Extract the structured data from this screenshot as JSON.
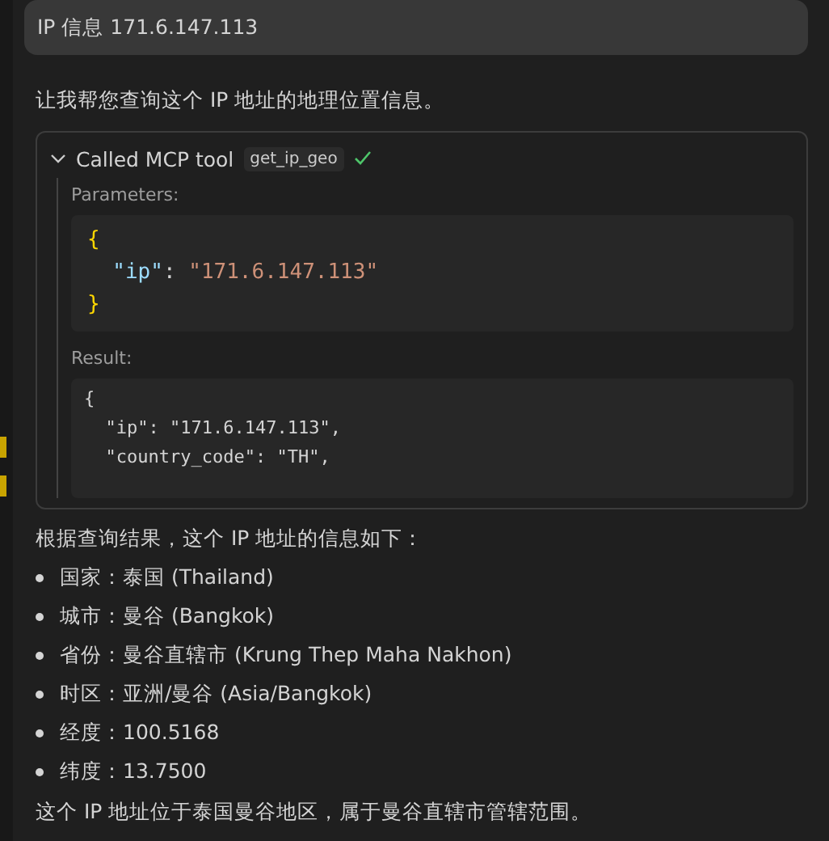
{
  "user_message": "IP 信息 171.6.147.113",
  "intro": "让我帮您查询这个 IP 地址的地理位置信息。",
  "tool_call": {
    "expanded": true,
    "label": "Called MCP tool",
    "tool_name": "get_ip_geo",
    "succeeded": true,
    "parameters_label": "Parameters:",
    "parameters_code": [
      [
        {
          "kind": "brace",
          "text": "{"
        }
      ],
      [
        {
          "kind": "key",
          "text": "\"ip\""
        },
        {
          "kind": "punct",
          "text": ": "
        },
        {
          "kind": "string",
          "text": "\"171.6.147.113\""
        }
      ],
      [
        {
          "kind": "brace",
          "text": "}"
        }
      ]
    ],
    "result_label": "Result:",
    "result_code": [
      "{",
      "  \"ip\": \"171.6.147.113\",",
      "  \"country_code\": \"TH\","
    ]
  },
  "summary": "根据查询结果，这个 IP 地址的信息如下：",
  "facts": [
    "国家：泰国 (Thailand)",
    "城市：曼谷 (Bangkok)",
    "省份：曼谷直辖市 (Krung Thep Maha Nakhon)",
    "时区：亚洲/曼谷 (Asia/Bangkok)",
    "经度：100.5168",
    "纬度：13.7500"
  ],
  "conclusion": "这个 IP 地址位于泰国曼谷地区，属于曼谷直辖市管辖范围。"
}
